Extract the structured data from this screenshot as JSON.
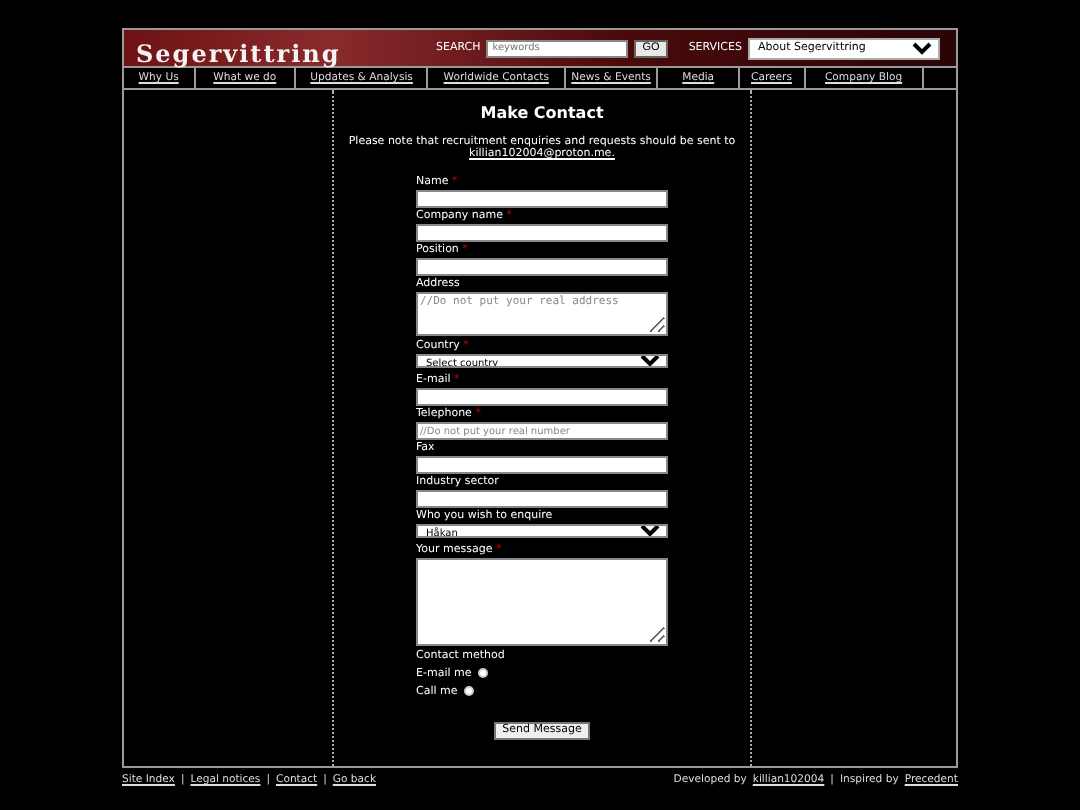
{
  "header": {
    "logo": "Segervittring",
    "search": {
      "label": "SEARCH",
      "placeholder": "keywords",
      "button": "GO"
    },
    "services": {
      "label": "SERVICES",
      "value": "About Segervittring"
    }
  },
  "nav": [
    {
      "label": "Why Us"
    },
    {
      "label": "What we do"
    },
    {
      "label": "Updates & Analysis"
    },
    {
      "label": "Worldwide Contacts"
    },
    {
      "label": "News & Events"
    },
    {
      "label": "Media"
    },
    {
      "label": "Careers"
    },
    {
      "label": "Company Blog"
    }
  ],
  "contact": {
    "title": "Make Contact",
    "note": "Please note that recruitment enquiries and requests should be sent to",
    "email": "killian102004@proton.me.",
    "fields": [
      {
        "kind": "input",
        "label": "Name",
        "required_mark": "*"
      },
      {
        "kind": "input",
        "label": "Company name",
        "required_mark": "*"
      },
      {
        "kind": "input",
        "label": "Position",
        "required_mark": "*"
      },
      {
        "kind": "textarea",
        "label": "Address",
        "placeholder": "//Do not put your real address"
      },
      {
        "kind": "select",
        "label": "Country",
        "required_mark": "*",
        "value": "Select country"
      },
      {
        "kind": "input",
        "label": "E-mail",
        "required_mark": "*"
      },
      {
        "kind": "input",
        "label": "Telephone",
        "required_mark": "*",
        "placeholder": "//Do not put your real number"
      },
      {
        "kind": "input",
        "label": "Fax"
      },
      {
        "kind": "input",
        "label": "Industry sector"
      },
      {
        "kind": "select",
        "label": "Who you wish to enquire",
        "value": "Håkan"
      },
      {
        "kind": "message",
        "label": "Your message",
        "required_mark": "*"
      }
    ],
    "method_label": "Contact method",
    "methods": [
      {
        "label": "E-mail me",
        "selected": false
      },
      {
        "label": "Call me",
        "selected": false
      }
    ],
    "submit": "Send Message"
  },
  "footer": {
    "left": [
      {
        "kind": "link",
        "text": "Site Index"
      },
      {
        "kind": "sep",
        "text": "|"
      },
      {
        "kind": "link",
        "text": "Legal notices"
      },
      {
        "kind": "sep",
        "text": "|"
      },
      {
        "kind": "link",
        "text": "Contact"
      },
      {
        "kind": "sep",
        "text": "|"
      },
      {
        "kind": "link",
        "text": "Go back"
      }
    ],
    "right": [
      {
        "kind": "text",
        "text": "Developed by"
      },
      {
        "kind": "link",
        "text": "killian102004"
      },
      {
        "kind": "sep",
        "text": "|"
      },
      {
        "kind": "text",
        "text": "Inspired by"
      },
      {
        "kind": "link",
        "text": "Precedent"
      }
    ]
  }
}
